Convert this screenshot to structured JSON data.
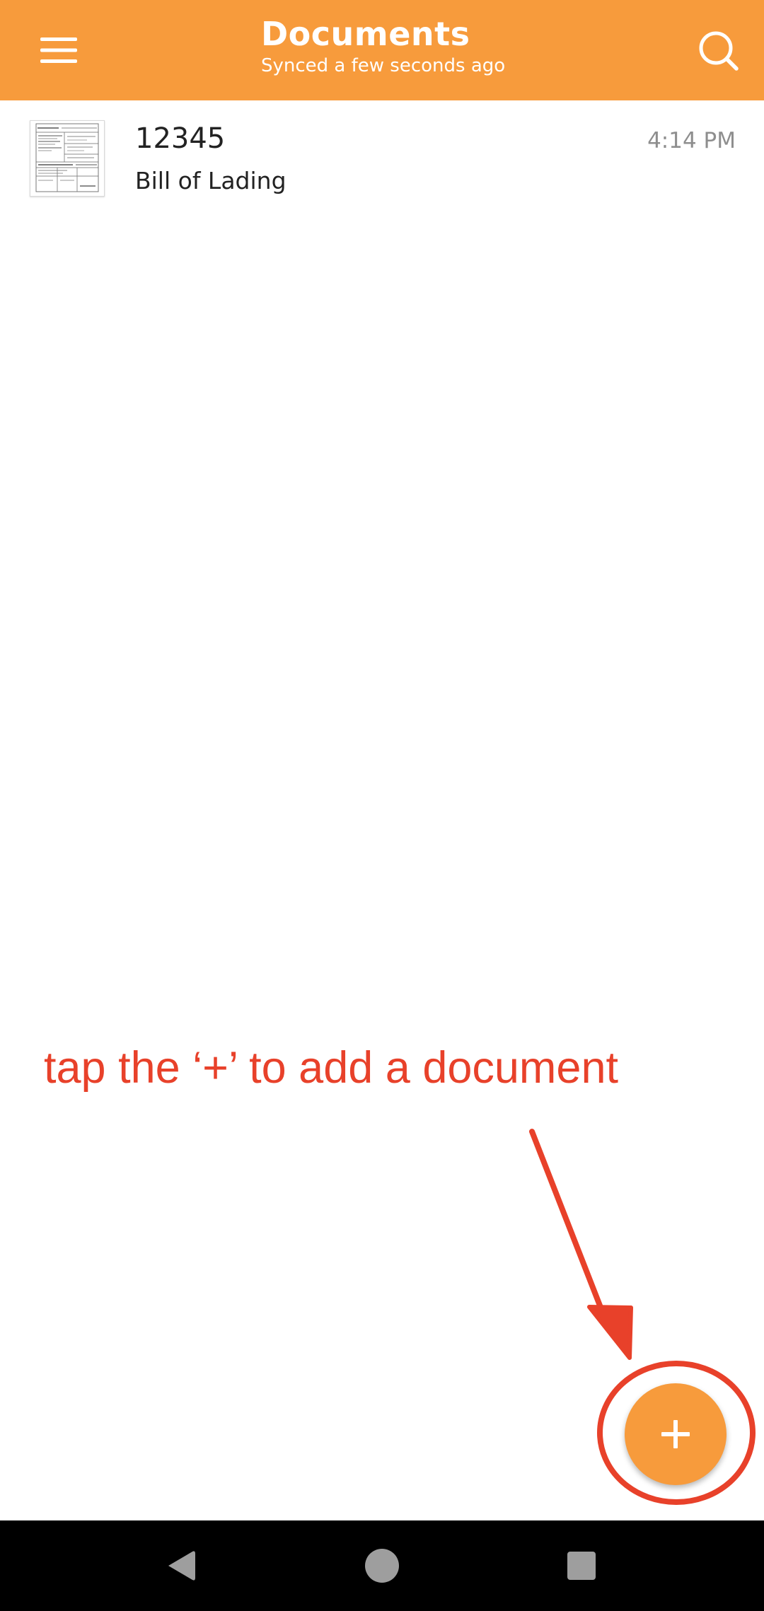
{
  "app_bar": {
    "title": "Documents",
    "subtitle": "Synced a few seconds ago",
    "background_color": "#f79b3c",
    "menu_icon": "hamburger-menu-icon",
    "search_icon": "search-icon"
  },
  "documents": [
    {
      "title": "12345",
      "type": "Bill of Lading",
      "time": "4:14 PM",
      "thumbnail_icon": "document-thumbnail"
    }
  ],
  "annotation": {
    "instruction": "tap the ‘+’ to add a document",
    "color": "#e8412a"
  },
  "fab": {
    "icon": "plus-icon",
    "color": "#f79b3c"
  },
  "system_nav": {
    "buttons": [
      "back-icon",
      "home-icon",
      "recents-icon"
    ]
  }
}
